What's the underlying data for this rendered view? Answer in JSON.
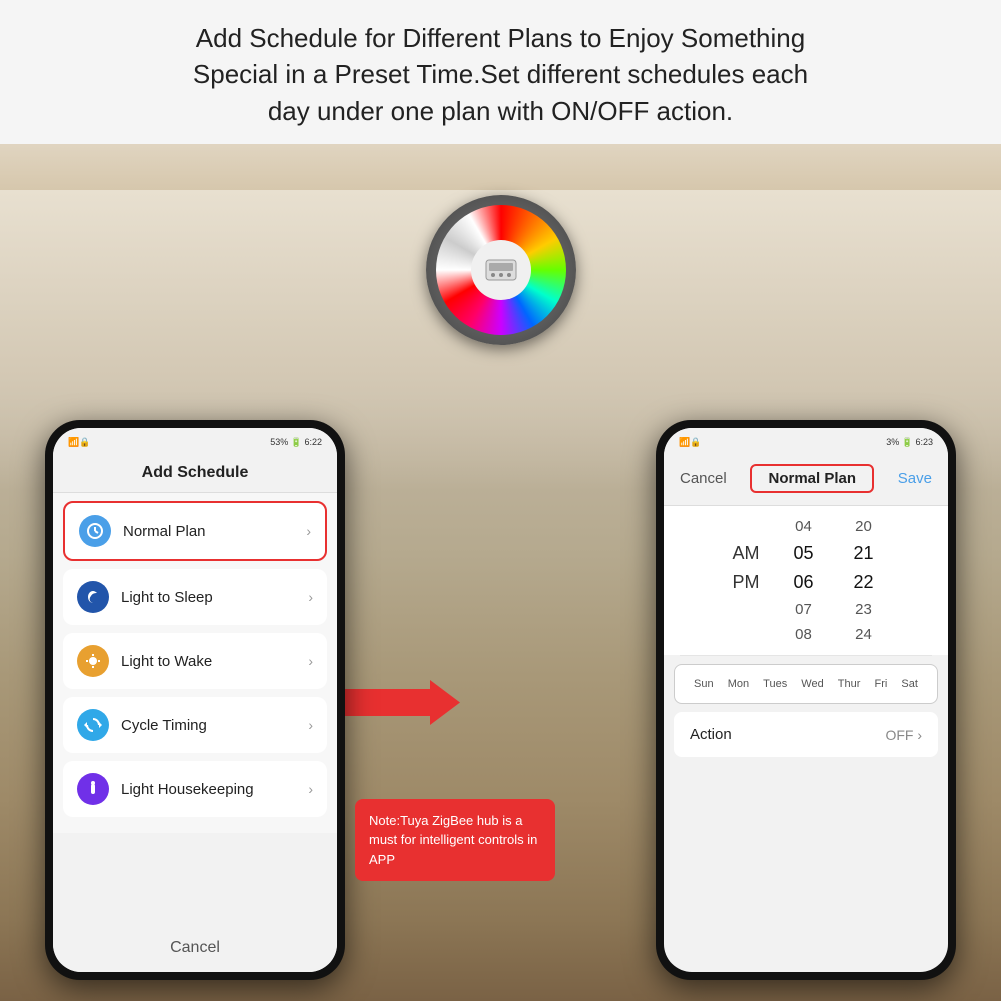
{
  "header": {
    "line1": "Add Schedule for Different Plans to Enjoy Something",
    "line2": "Special in a Preset Time.Set different schedules each",
    "line3": "day under one plan with ON/OFF action."
  },
  "phone_left": {
    "status_left": "📶🔒",
    "status_right": "53% 🔋 6:22",
    "screen_title": "Add Schedule",
    "items": [
      {
        "label": "Normal Plan",
        "icon": "🕐",
        "icon_class": "icon-blue",
        "highlighted": true
      },
      {
        "label": "Light to Sleep",
        "icon": "🌙",
        "icon_class": "icon-dark-blue",
        "highlighted": false
      },
      {
        "label": "Light to Wake",
        "icon": "☀️",
        "icon_class": "icon-orange",
        "highlighted": false
      },
      {
        "label": "Cycle Timing",
        "icon": "🔄",
        "icon_class": "icon-green",
        "highlighted": false
      },
      {
        "label": "Light Housekeeping",
        "icon": "🔊",
        "icon_class": "icon-purple",
        "highlighted": false
      }
    ],
    "cancel_label": "Cancel"
  },
  "phone_right": {
    "status_left": "📶🔒",
    "status_right": "3% 🔋 6:23",
    "cancel_label": "Cancel",
    "title": "Normal Plan",
    "save_label": "Save",
    "time_rows": [
      {
        "ampm": "",
        "hour": "04",
        "minute": "20"
      },
      {
        "ampm": "AM",
        "hour": "05",
        "minute": "21",
        "selected": true
      },
      {
        "ampm": "PM",
        "hour": "06",
        "minute": "22",
        "selected": true
      },
      {
        "ampm": "",
        "hour": "07",
        "minute": "23"
      },
      {
        "ampm": "",
        "hour": "08",
        "minute": "24"
      }
    ],
    "days": [
      "Sun",
      "Mon",
      "Tues",
      "Wed",
      "Thur",
      "Fri",
      "Sat"
    ],
    "action_label": "Action",
    "action_value": "OFF ›"
  },
  "arrow": {
    "color": "#e83030"
  },
  "note": {
    "text": "Note:Tuya ZigBee hub is a must for intelligent controls in APP"
  }
}
